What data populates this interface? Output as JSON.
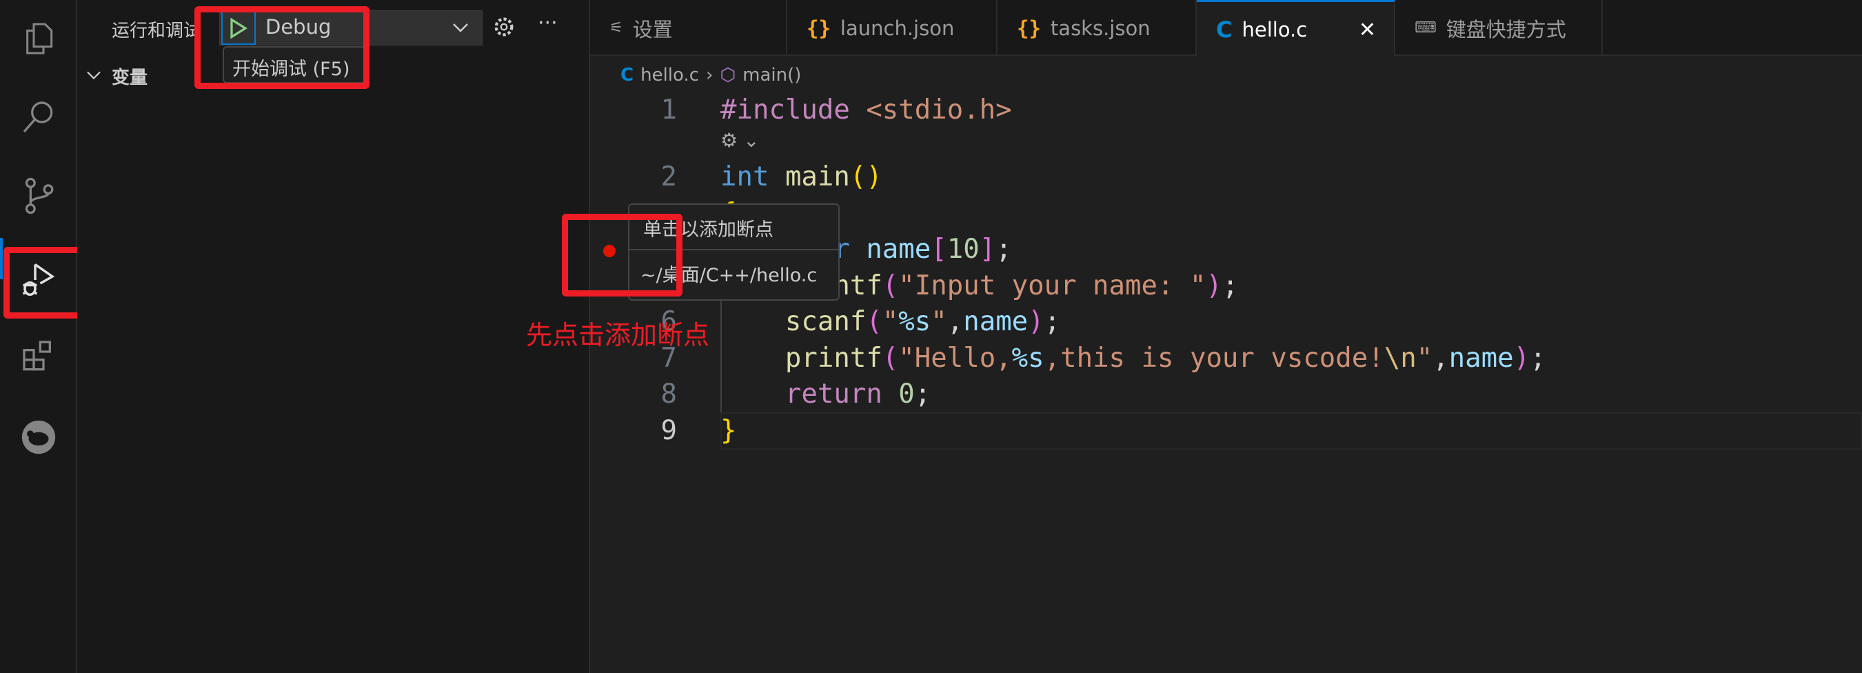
{
  "sidebar": {
    "title": "运行和调试",
    "config": "Debug",
    "start_tooltip": "开始调试 (F5)",
    "section": "变量"
  },
  "tabs": [
    {
      "label": "设置",
      "icon": "settings-icon"
    },
    {
      "label": "launch.json",
      "icon": "json-braces-icon"
    },
    {
      "label": "tasks.json",
      "icon": "json-braces-icon"
    },
    {
      "label": "hello.c",
      "icon": "c-file-icon",
      "active": true
    },
    {
      "label": "键盘快捷方式",
      "icon": "keyboard-icon"
    }
  ],
  "breadcrumb": {
    "file": "hello.c",
    "symbol": "main()"
  },
  "hover": {
    "line1": "单击以添加断点",
    "line2": "~/桌面/C++/hello.c"
  },
  "annotation": "先点击添加断点",
  "line_numbers": [
    "1",
    "2",
    "6",
    "7",
    "8",
    "9"
  ],
  "colors": {
    "accent": "#0078d4",
    "annotation": "#ee1c25",
    "breakpoint": "#e51400"
  },
  "code": [
    [
      [
        "#include",
        "kw"
      ],
      [
        " <stdio.h>",
        "str"
      ]
    ],
    [
      [
        "int",
        "type"
      ],
      [
        " ",
        "p"
      ],
      [
        "main",
        "fn"
      ],
      [
        "()",
        "b1"
      ]
    ],
    [
      [
        "{",
        "b1"
      ]
    ],
    [
      [
        "    ",
        "p"
      ],
      [
        "char",
        "type"
      ],
      [
        " ",
        "p"
      ],
      [
        "name",
        "var"
      ],
      [
        "[",
        "b2"
      ],
      [
        "10",
        "num"
      ],
      [
        "]",
        "b2"
      ],
      [
        ";",
        "p"
      ]
    ],
    [
      [
        "    ",
        "p"
      ],
      [
        "printf",
        "fn"
      ],
      [
        "(",
        "b2"
      ],
      [
        "\"Input your name: \"",
        "str"
      ],
      [
        ")",
        "b2"
      ],
      [
        ";",
        "p"
      ]
    ],
    [
      [
        "    ",
        "p"
      ],
      [
        "scanf",
        "fn"
      ],
      [
        "(",
        "b2"
      ],
      [
        "\"",
        "str"
      ],
      [
        "%s",
        "var"
      ],
      [
        "\"",
        "str"
      ],
      [
        ",",
        "p"
      ],
      [
        "name",
        "var"
      ],
      [
        ")",
        "b2"
      ],
      [
        ";",
        "p"
      ]
    ],
    [
      [
        "    ",
        "p"
      ],
      [
        "printf",
        "fn"
      ],
      [
        "(",
        "b2"
      ],
      [
        "\"Hello,",
        "str"
      ],
      [
        "%s",
        "var"
      ],
      [
        ",this is your vscode!",
        "str"
      ],
      [
        "\\n",
        "esc"
      ],
      [
        "\"",
        "str"
      ],
      [
        ",",
        "p"
      ],
      [
        "name",
        "var"
      ],
      [
        ")",
        "b2"
      ],
      [
        ";",
        "p"
      ]
    ],
    [
      [
        "    ",
        "p"
      ],
      [
        "return",
        "kw"
      ],
      [
        " ",
        "p"
      ],
      [
        "0",
        "num"
      ],
      [
        ";",
        "p"
      ]
    ],
    [
      [
        "}",
        "b1"
      ]
    ]
  ]
}
